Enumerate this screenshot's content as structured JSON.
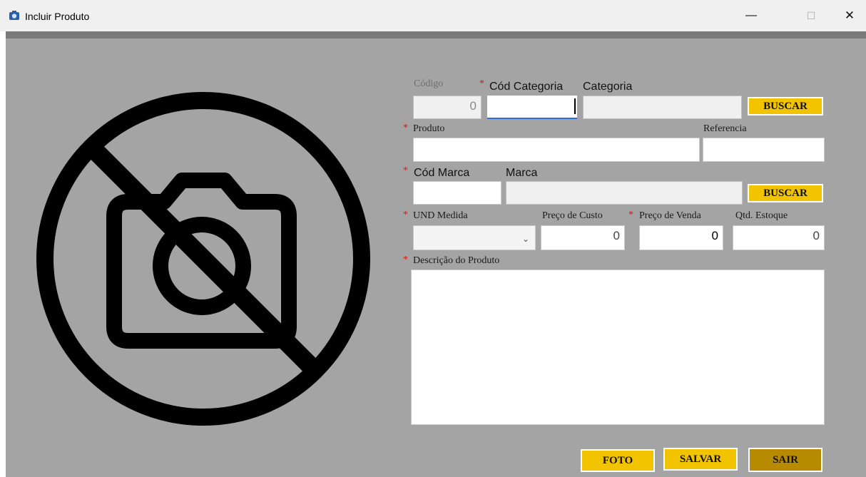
{
  "window": {
    "title": "Incluir Produto",
    "minimize": "—",
    "maximize": "☐",
    "close": "✕"
  },
  "fields": {
    "codigo": {
      "label": "Código",
      "value": "0"
    },
    "cod_categoria": {
      "label": "Cód Categoria",
      "value": "",
      "required": "*"
    },
    "categoria": {
      "label": "Categoria",
      "value": ""
    },
    "produto": {
      "label": "Produto",
      "value": "",
      "required": "*"
    },
    "referencia": {
      "label": "Referencia",
      "value": ""
    },
    "cod_marca": {
      "label": "Cód Marca",
      "value": "",
      "required": "*"
    },
    "marca": {
      "label": "Marca",
      "value": ""
    },
    "und_medida": {
      "label": "UND Medida",
      "value": "",
      "required": "*"
    },
    "preco_custo": {
      "label": "Preço de Custo",
      "value": "0"
    },
    "preco_venda": {
      "label": "Preço de Venda",
      "value": "0",
      "required": "*"
    },
    "qtd_estoque": {
      "label": "Qtd. Estoque",
      "value": "0"
    },
    "descricao": {
      "label": "Descrição do Produto",
      "value": "",
      "required": "*"
    }
  },
  "buttons": {
    "buscar_categoria": "BUSCAR",
    "buscar_marca": "BUSCAR",
    "foto": "FOTO",
    "salvar": "SALVAR",
    "sair": "SAIR"
  },
  "photo": {
    "icon": "no-camera-icon"
  },
  "colors": {
    "form_bg": "#a4a4a4",
    "button": "#f2c400",
    "button_dark": "#b78a00",
    "required": "#c81e1e",
    "focus": "#2b6fd6"
  }
}
